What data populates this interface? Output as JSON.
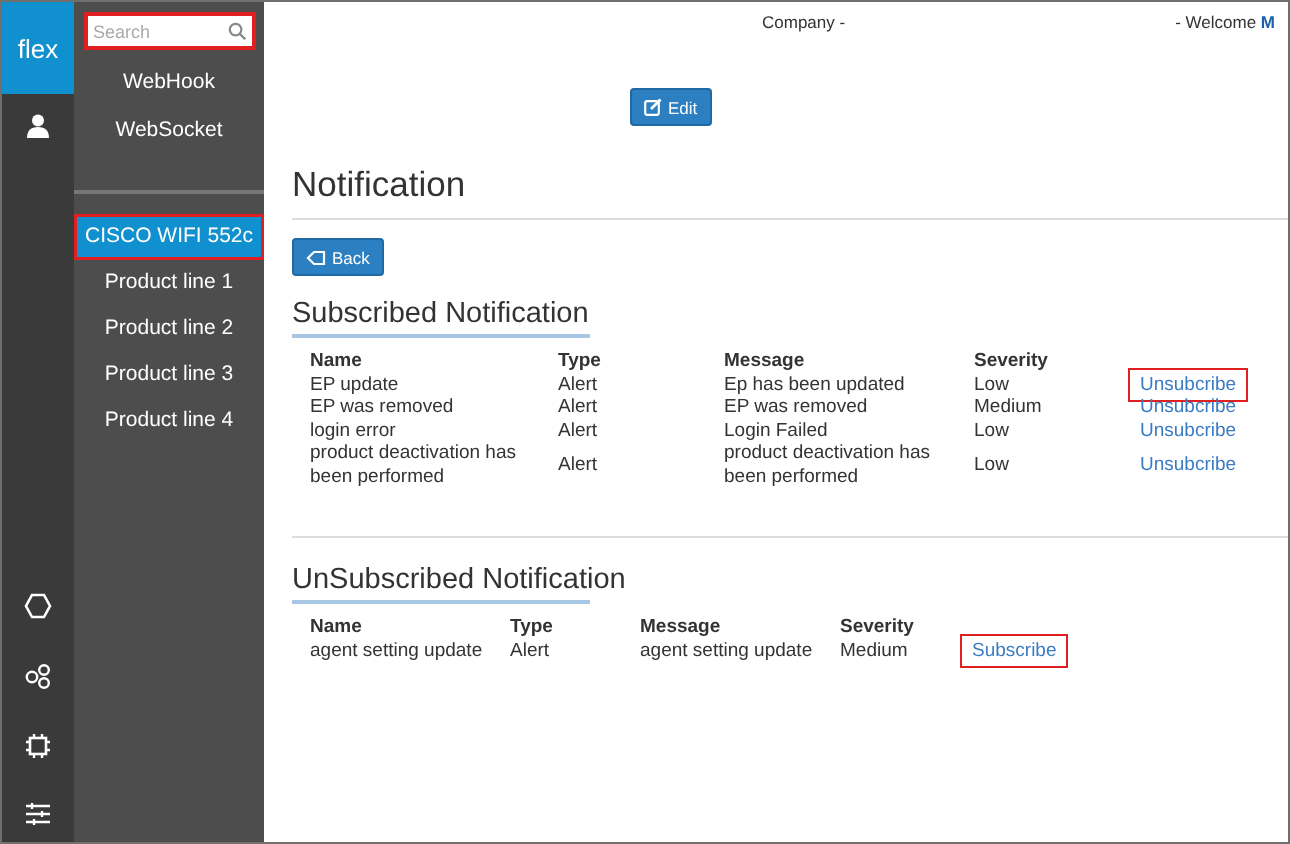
{
  "rail": {
    "logo": "flex"
  },
  "search": {
    "placeholder": "Search",
    "highlighted": true
  },
  "sidebar": {
    "top_items": [
      {
        "label": "WebHook",
        "selected": false
      },
      {
        "label": "WebSocket",
        "selected": false
      }
    ],
    "items": [
      {
        "label": "CISCO WIFI 552c",
        "selected": true,
        "highlighted": true
      },
      {
        "label": "Product line 1",
        "selected": false,
        "highlighted": false
      },
      {
        "label": "Product line 2",
        "selected": false,
        "highlighted": false
      },
      {
        "label": "Product line 3",
        "selected": false,
        "highlighted": false
      },
      {
        "label": "Product line 4",
        "selected": false,
        "highlighted": false
      }
    ]
  },
  "header": {
    "company": "Company -",
    "welcome": "- Welcome",
    "user": "M"
  },
  "edit_button": "Edit",
  "title": "Notification",
  "back_button": "Back",
  "sections": [
    {
      "heading": "Subscribed Notification",
      "columns": [
        "Name",
        "Type",
        "Message",
        "Severity"
      ],
      "rows": [
        {
          "name": "EP update",
          "type": "Alert",
          "message": "Ep has been updated",
          "severity": "Low",
          "action": "Unsubcribe",
          "highlighted": true
        },
        {
          "name": "EP was removed",
          "type": "Alert",
          "message": "EP was removed",
          "severity": "Medium",
          "action": "Unsubcribe",
          "highlighted": false
        },
        {
          "name": "login error",
          "type": "Alert",
          "message": "Login Failed",
          "severity": "Low",
          "action": "Unsubcribe",
          "highlighted": false
        },
        {
          "name": "product deactivation has been performed",
          "type": "Alert",
          "message": "product deactivation has been performed",
          "severity": "Low",
          "action": "Unsubcribe",
          "highlighted": false
        }
      ]
    },
    {
      "heading": "UnSubscribed Notification",
      "columns": [
        "Name",
        "Type",
        "Message",
        "Severity"
      ],
      "rows": [
        {
          "name": "agent setting update",
          "type": "Alert",
          "message": "agent setting update",
          "severity": "Medium",
          "action": "Subscribe",
          "highlighted": true
        }
      ]
    }
  ]
}
